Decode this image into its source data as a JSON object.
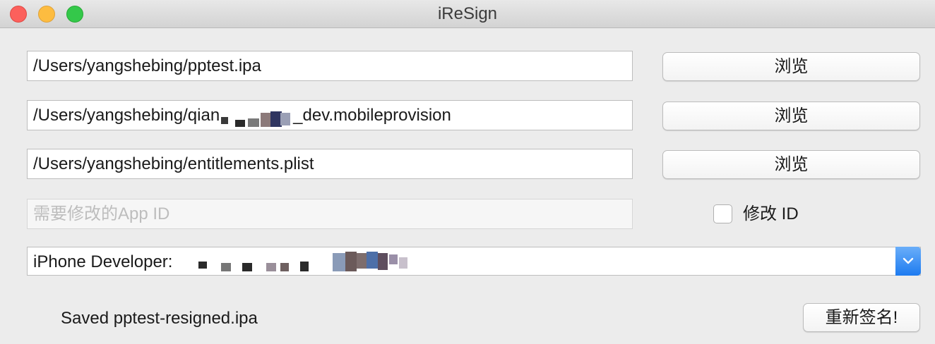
{
  "window": {
    "title": "iReSign"
  },
  "fields": {
    "ipa_path": "/Users/yangshebing/pptest.ipa",
    "provision_path_prefix": "/Users/yangshebing/qian",
    "provision_path_suffix": "_dev.mobileprovision",
    "entitlements_path": "/Users/yangshebing/entitlements.plist",
    "app_id_placeholder": "需要修改的App ID"
  },
  "buttons": {
    "browse_ipa": "浏览",
    "browse_provision": "浏览",
    "browse_entitlements": "浏览",
    "resign": "重新签名!"
  },
  "checkbox": {
    "label": "修改 ID",
    "checked": false
  },
  "certificate": {
    "selected_prefix": "iPhone Developer:"
  },
  "status": {
    "message": "Saved pptest-resigned.ipa"
  },
  "colors": {
    "accent": "#1d7bf0",
    "close": "#fc605c",
    "minimize": "#fdbc40",
    "maximize": "#34c84a"
  }
}
